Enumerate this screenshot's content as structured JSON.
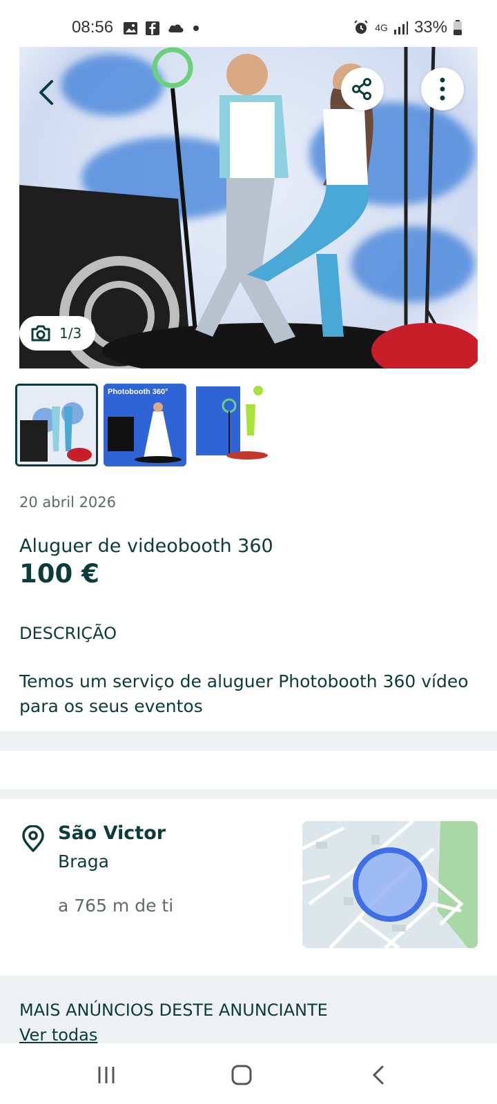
{
  "status_bar": {
    "time": "08:56",
    "network": "4G",
    "battery": "33%"
  },
  "hero": {
    "photo_counter": "1/3"
  },
  "thumbnails": [
    {
      "caption": ""
    },
    {
      "caption": "Photobooth 360°"
    },
    {
      "caption": ""
    }
  ],
  "listing": {
    "date": "20 abril 2026",
    "title": "Aluguer de videobooth 360",
    "price": "100 €",
    "description_heading": "DESCRIÇÃO",
    "description": "Temos um serviço de aluguer Photobooth 360 vídeo para os seus eventos"
  },
  "location": {
    "city": "São Victor",
    "region": "Braga",
    "distance": "a 765 m de ti"
  },
  "more": {
    "heading": "MAIS ANÚNCIOS DESTE ANUNCIANTE",
    "see_all": "Ver todas"
  },
  "colors": {
    "primary": "#0b3b3a",
    "band": "#edf1f1",
    "map_marker": "#3f6fe6"
  }
}
